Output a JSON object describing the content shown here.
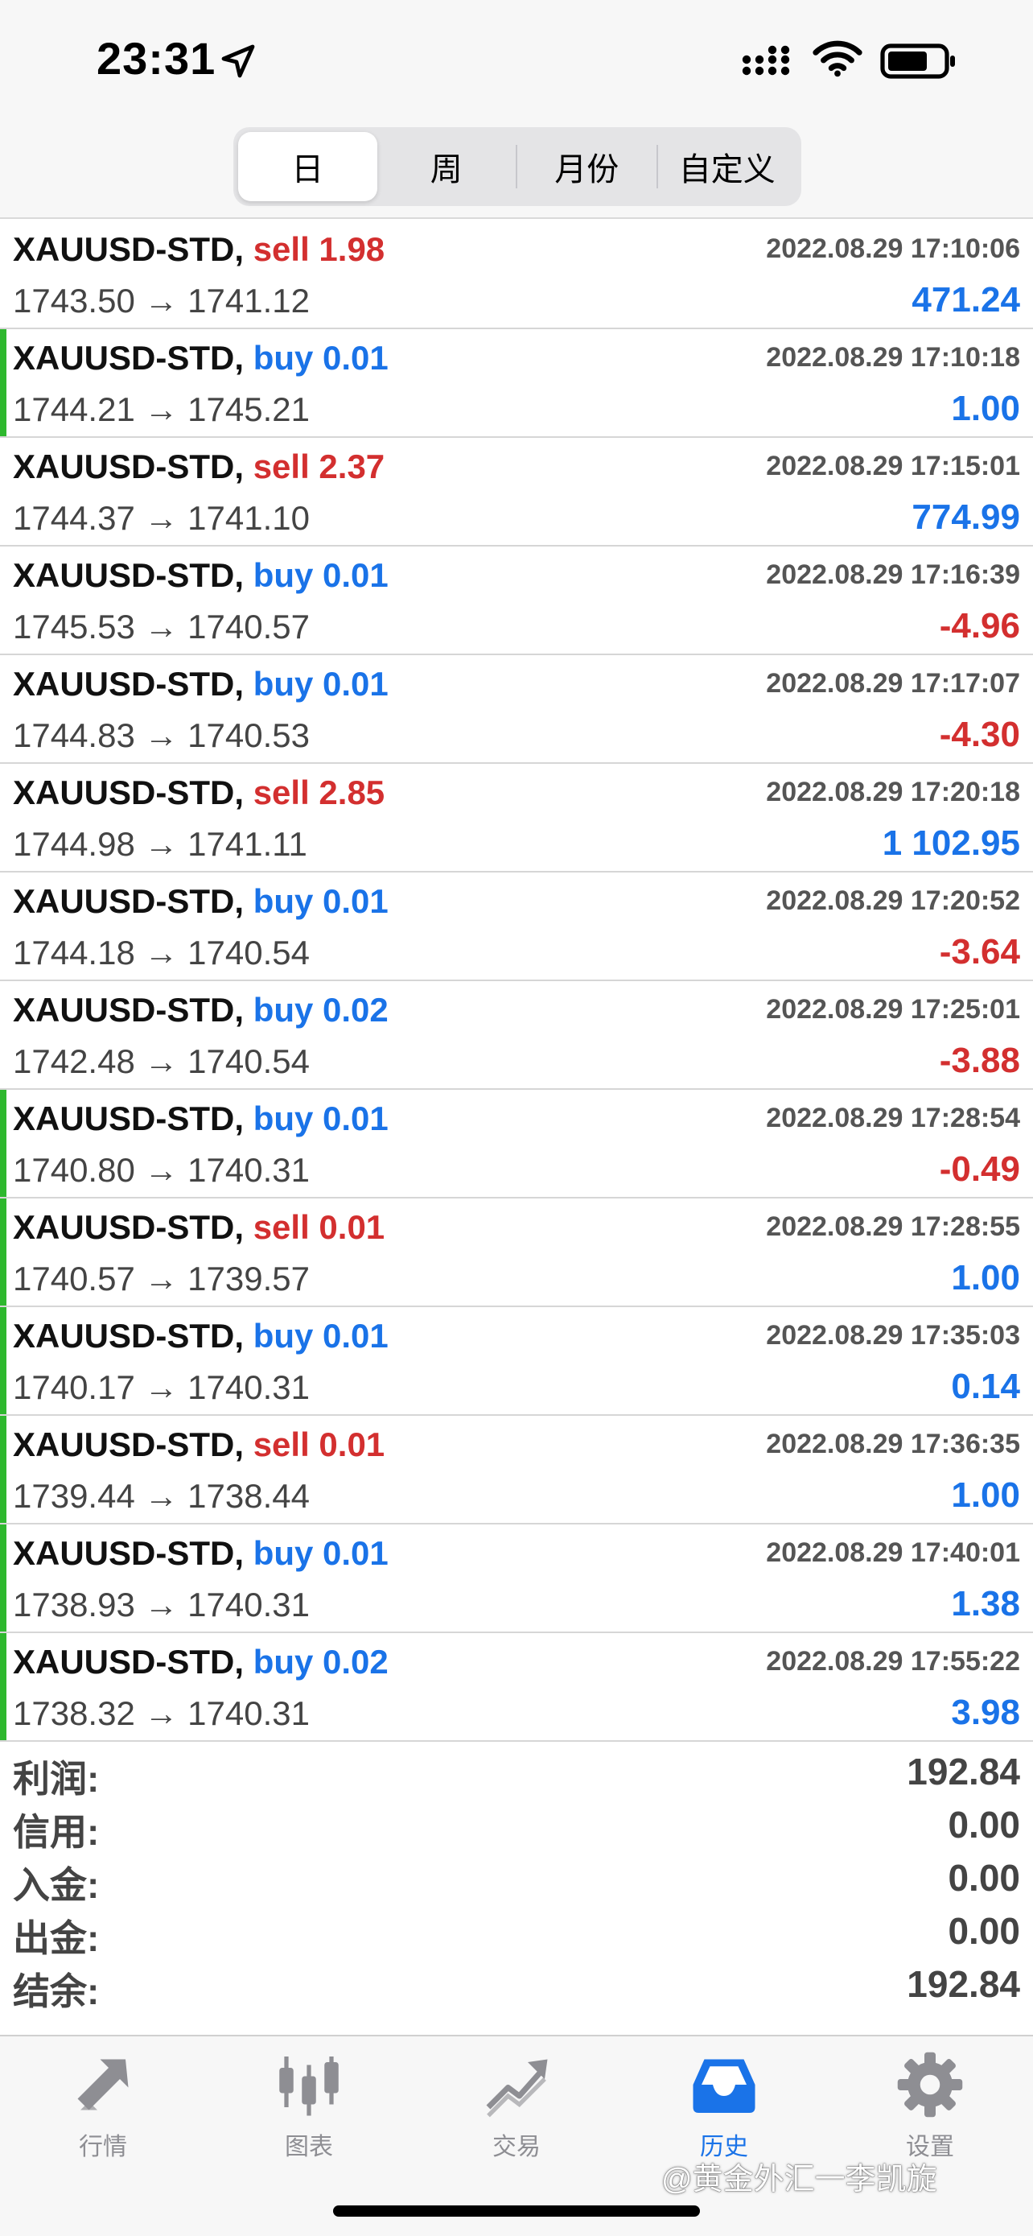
{
  "status_bar": {
    "time": "23:31",
    "icons": [
      "location-arrow-icon",
      "cellular-signal-icon",
      "wifi-icon",
      "battery-icon"
    ]
  },
  "period_tabs": {
    "items": [
      "日",
      "周",
      "月份",
      "自定义"
    ],
    "selected": "日"
  },
  "deals": [
    {
      "symbol": "XAUUSD-STD,",
      "side": "sell",
      "volume": "1.98",
      "time": "2022.08.29 17:10:06",
      "prices": "1743.50 → 1741.12",
      "profit": "471.24",
      "profit_sign": "pos",
      "bar": false
    },
    {
      "symbol": "XAUUSD-STD,",
      "side": "buy",
      "volume": "0.01",
      "time": "2022.08.29 17:10:18",
      "prices": "1744.21 → 1745.21",
      "profit": "1.00",
      "profit_sign": "pos",
      "bar": true
    },
    {
      "symbol": "XAUUSD-STD,",
      "side": "sell",
      "volume": "2.37",
      "time": "2022.08.29 17:15:01",
      "prices": "1744.37 → 1741.10",
      "profit": "774.99",
      "profit_sign": "pos",
      "bar": false
    },
    {
      "symbol": "XAUUSD-STD,",
      "side": "buy",
      "volume": "0.01",
      "time": "2022.08.29 17:16:39",
      "prices": "1745.53 → 1740.57",
      "profit": "-4.96",
      "profit_sign": "neg",
      "bar": false
    },
    {
      "symbol": "XAUUSD-STD,",
      "side": "buy",
      "volume": "0.01",
      "time": "2022.08.29 17:17:07",
      "prices": "1744.83 → 1740.53",
      "profit": "-4.30",
      "profit_sign": "neg",
      "bar": false
    },
    {
      "symbol": "XAUUSD-STD,",
      "side": "sell",
      "volume": "2.85",
      "time": "2022.08.29 17:20:18",
      "prices": "1744.98 → 1741.11",
      "profit": "1 102.95",
      "profit_sign": "pos",
      "bar": false
    },
    {
      "symbol": "XAUUSD-STD,",
      "side": "buy",
      "volume": "0.01",
      "time": "2022.08.29 17:20:52",
      "prices": "1744.18 → 1740.54",
      "profit": "-3.64",
      "profit_sign": "neg",
      "bar": false
    },
    {
      "symbol": "XAUUSD-STD,",
      "side": "buy",
      "volume": "0.02",
      "time": "2022.08.29 17:25:01",
      "prices": "1742.48 → 1740.54",
      "profit": "-3.88",
      "profit_sign": "neg",
      "bar": false
    },
    {
      "symbol": "XAUUSD-STD,",
      "side": "buy",
      "volume": "0.01",
      "time": "2022.08.29 17:28:54",
      "prices": "1740.80 → 1740.31",
      "profit": "-0.49",
      "profit_sign": "neg",
      "bar": true
    },
    {
      "symbol": "XAUUSD-STD,",
      "side": "sell",
      "volume": "0.01",
      "time": "2022.08.29 17:28:55",
      "prices": "1740.57 → 1739.57",
      "profit": "1.00",
      "profit_sign": "pos",
      "bar": true
    },
    {
      "symbol": "XAUUSD-STD,",
      "side": "buy",
      "volume": "0.01",
      "time": "2022.08.29 17:35:03",
      "prices": "1740.17 → 1740.31",
      "profit": "0.14",
      "profit_sign": "pos",
      "bar": true
    },
    {
      "symbol": "XAUUSD-STD,",
      "side": "sell",
      "volume": "0.01",
      "time": "2022.08.29 17:36:35",
      "prices": "1739.44 → 1738.44",
      "profit": "1.00",
      "profit_sign": "pos",
      "bar": true
    },
    {
      "symbol": "XAUUSD-STD,",
      "side": "buy",
      "volume": "0.01",
      "time": "2022.08.29 17:40:01",
      "prices": "1738.93 → 1740.31",
      "profit": "1.38",
      "profit_sign": "pos",
      "bar": true
    },
    {
      "symbol": "XAUUSD-STD,",
      "side": "buy",
      "volume": "0.02",
      "time": "2022.08.29 17:55:22",
      "prices": "1738.32 → 1740.31",
      "profit": "3.98",
      "profit_sign": "pos",
      "bar": true
    }
  ],
  "summary": [
    {
      "label": "利润:",
      "value": "192.84"
    },
    {
      "label": "信用:",
      "value": "0.00"
    },
    {
      "label": "入金:",
      "value": "0.00"
    },
    {
      "label": "出金:",
      "value": "0.00"
    },
    {
      "label": "结余:",
      "value": "192.84"
    }
  ],
  "tab_bar": {
    "items": [
      {
        "label": "行情",
        "icon": "quotes-arrows-icon"
      },
      {
        "label": "图表",
        "icon": "candlestick-chart-icon"
      },
      {
        "label": "交易",
        "icon": "trade-trend-icon"
      },
      {
        "label": "历史",
        "icon": "history-inbox-icon"
      },
      {
        "label": "设置",
        "icon": "settings-gear-icon"
      }
    ],
    "selected": "历史"
  },
  "watermark": "@黄金外汇一李凯旋",
  "colors": {
    "buy": "#1a73e8",
    "sell": "#d32f2f",
    "positive_profit": "#1a73e8",
    "negative_profit": "#d32f2f",
    "marker_bar": "#2eb82e",
    "tab_active": "#1a73e8",
    "tab_inactive": "#8e8e93"
  }
}
